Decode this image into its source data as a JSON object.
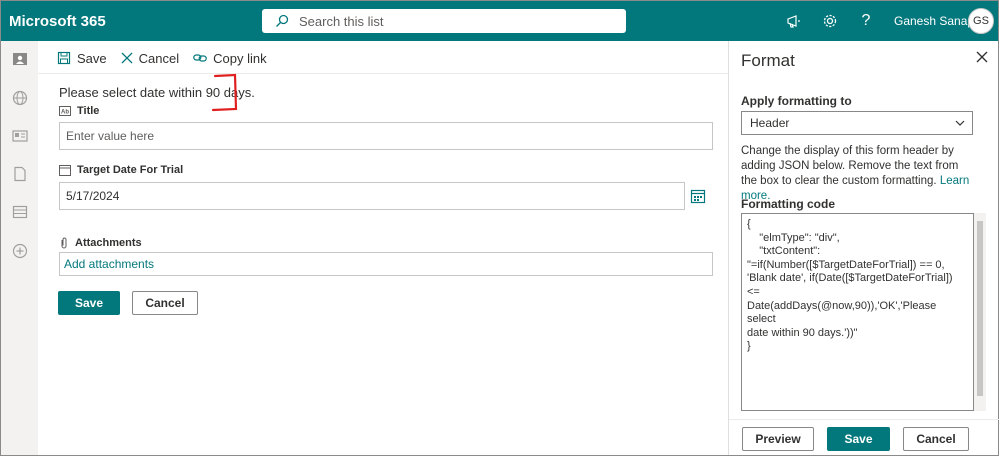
{
  "topbar": {
    "app_title": "Microsoft 365",
    "search_placeholder": "Search this list",
    "user_name": "Ganesh Sanap",
    "user_initials": "GS",
    "brand_color": "#03787c"
  },
  "toolbar": {
    "save_label": "Save",
    "cancel_label": "Cancel",
    "copy_link_label": "Copy link"
  },
  "form": {
    "header_text": "Please select date within 90 days.",
    "title_label": "Title",
    "title_placeholder": "Enter value here",
    "date_label": "Target Date For Trial",
    "date_value": "5/17/2024",
    "attachments_label": "Attachments",
    "add_attachments": "Add attachments",
    "save_label": "Save",
    "cancel_label": "Cancel"
  },
  "panel": {
    "title": "Format",
    "apply_label": "Apply formatting to",
    "apply_value": "Header",
    "description": "Change the display of this form header by adding JSON below. Remove the text from the box to clear the custom formatting.",
    "learn_more": "Learn more.",
    "code_label": "Formatting code",
    "code": "{\n    \"elmType\": \"div\",\n    \"txtContent\":\n\"=if(Number([$TargetDateForTrial]) == 0,\n'Blank date', if(Date([$TargetDateForTrial]) <=\nDate(addDays(@now,90)),'OK','Please select\ndate within 90 days.'))\"\n}",
    "preview_label": "Preview",
    "save_label": "Save",
    "cancel_label": "Cancel"
  }
}
